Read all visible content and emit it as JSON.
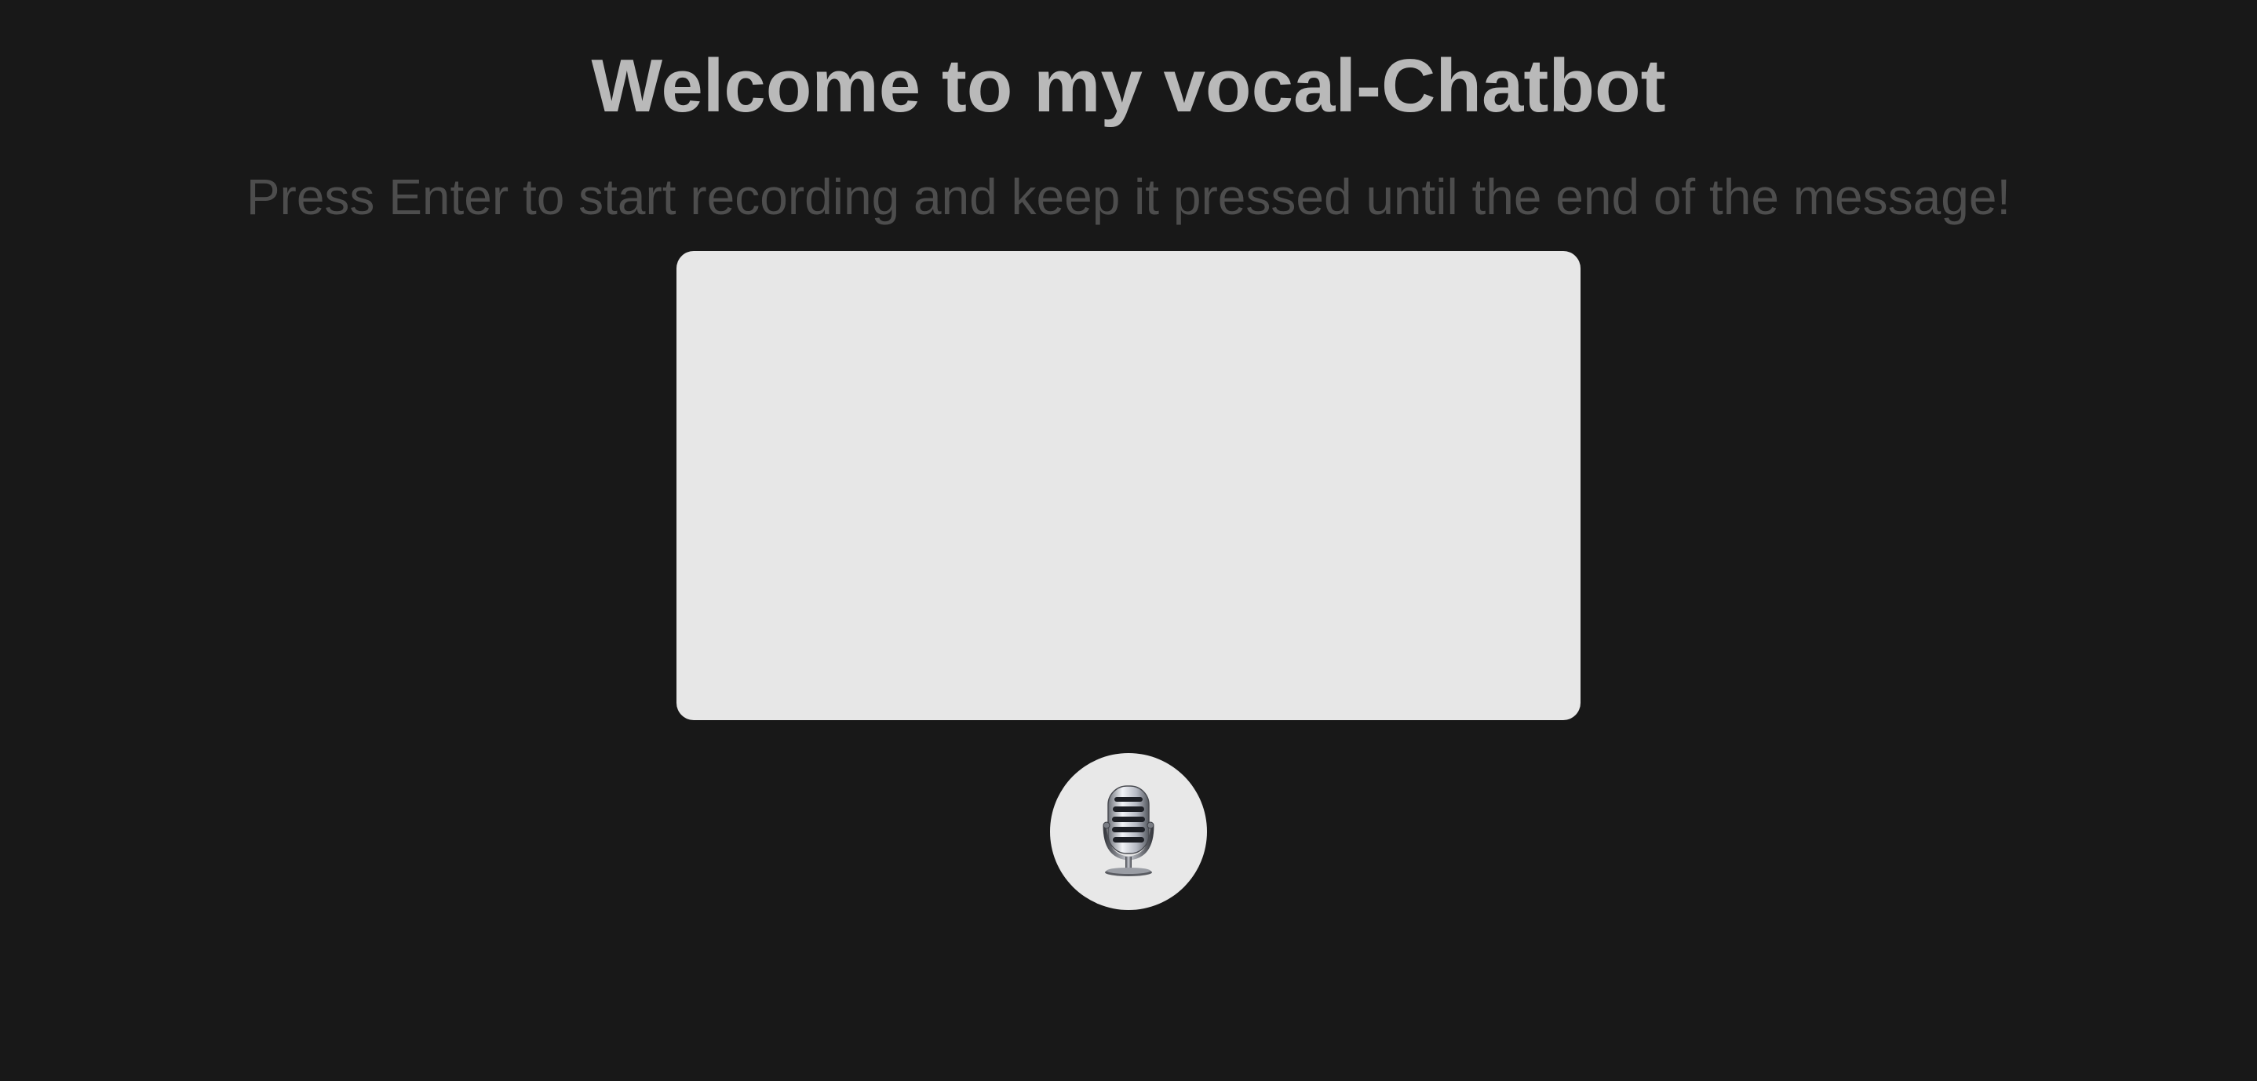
{
  "header": {
    "title": "Welcome to my vocal-Chatbot",
    "subtitle": "Press Enter to start recording and keep it pressed until the end of the message!"
  },
  "chat": {
    "messages": []
  },
  "mic_button": {
    "icon": "microphone-icon"
  },
  "colors": {
    "background": "#181818",
    "title": "#b9b9b9",
    "subtitle": "#4d4d4d",
    "chat_box": "#e7e7e7",
    "mic_button": "#e8e8e8"
  }
}
